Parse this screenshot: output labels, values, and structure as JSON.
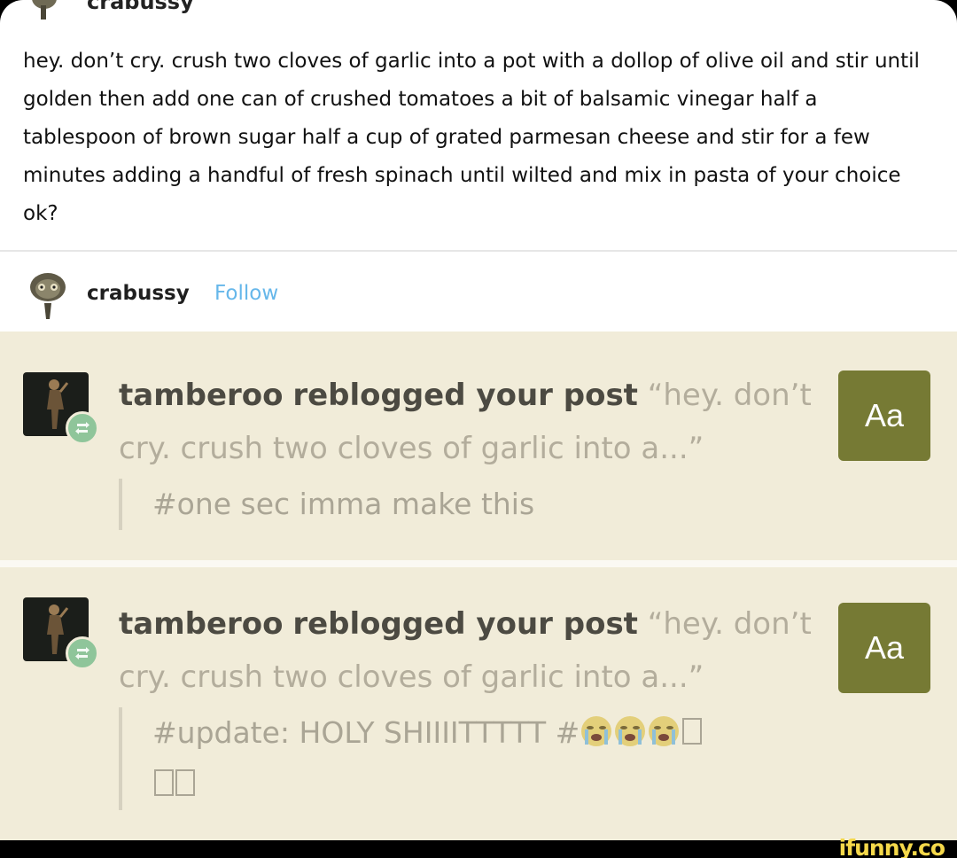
{
  "post": {
    "username": "crabussy",
    "body": "hey. don’t cry. crush two cloves of garlic into a pot with a dollop of olive oil and stir until golden then add one can of crushed tomatoes a bit of balsamic vinegar half a tablespoon of brown sugar half a cup of grated parmesan cheese and stir for a few minutes adding a handful of fresh spinach until wilted and mix in pasta of your choice ok?"
  },
  "byline": {
    "username": "crabussy",
    "follow_label": "Follow"
  },
  "notifications": [
    {
      "actor": "tamberoo",
      "action": "reblogged your post",
      "excerpt": "“hey. don’t cry. crush two cloves of garlic into a...”",
      "tags": "#one sec imma make this",
      "button_label": "Aa"
    },
    {
      "actor": "tamberoo",
      "action": "reblogged your post",
      "excerpt": "“hey. don’t cry. crush two cloves of garlic into a...”",
      "tags": "#update: HOLY SHIIIITTTTT #",
      "button_label": "Aa"
    }
  ],
  "watermark": "ifunny.co",
  "colors": {
    "notes_bg": "#f1ecd9",
    "aa_button": "#767a34",
    "follow": "#66b7ea",
    "reblog_badge": "#8fc59a"
  },
  "icons": [
    "avatar",
    "reblog-icon",
    "crying-face-emoji"
  ]
}
